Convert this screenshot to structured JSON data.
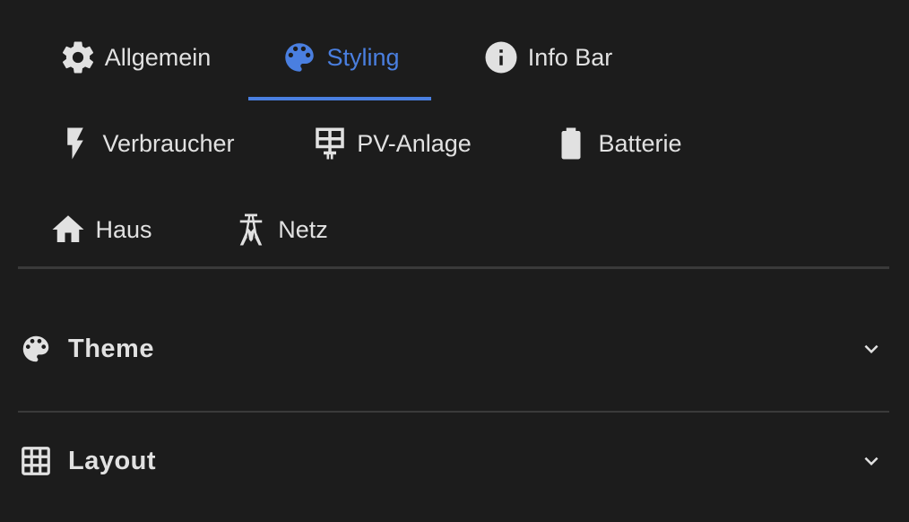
{
  "tabs": [
    {
      "label": "Allgemein",
      "icon": "gear-icon",
      "active": false
    },
    {
      "label": "Styling",
      "icon": "palette-icon",
      "active": true
    },
    {
      "label": "Info Bar",
      "icon": "info-icon",
      "active": false
    },
    {
      "label": "Verbraucher",
      "icon": "lightning-icon",
      "active": false
    },
    {
      "label": "PV-Anlage",
      "icon": "solar-panel-icon",
      "active": false
    },
    {
      "label": "Batterie",
      "icon": "battery-icon",
      "active": false
    },
    {
      "label": "Haus",
      "icon": "home-icon",
      "active": false
    },
    {
      "label": "Netz",
      "icon": "transmission-tower-icon",
      "active": false
    }
  ],
  "sections": [
    {
      "title": "Theme",
      "icon": "palette-icon",
      "expanded": false
    },
    {
      "title": "Layout",
      "icon": "grid-icon",
      "expanded": false
    }
  ],
  "colors": {
    "background": "#1c1c1c",
    "accent": "#4a7fe0",
    "text": "#e1e1e1",
    "divider": "#3a3a3a"
  }
}
